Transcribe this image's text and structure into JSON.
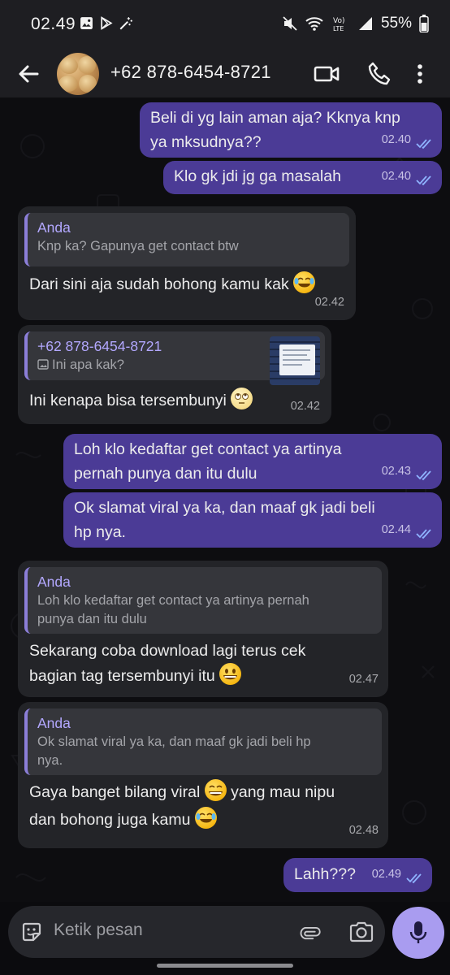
{
  "status_bar": {
    "time": "02.49",
    "battery": "55%",
    "icons": [
      "gallery-icon",
      "play-store-icon",
      "magic-wand-icon",
      "mute-icon",
      "wifi-icon",
      "volte-icon",
      "signal-icon",
      "battery-icon"
    ]
  },
  "header": {
    "contact": "+62 878-6454-8721",
    "icons": [
      "back-arrow-icon",
      "video-call-icon",
      "phone-icon",
      "more-vert-icon"
    ]
  },
  "messages": [
    {
      "side": "out",
      "lines": [
        "Beli di yg lain aman aja? Kknya knp",
        "ya mksudnya??"
      ],
      "time": "02.40",
      "read": true
    },
    {
      "side": "out",
      "lines": [
        "Klo gk jdi jg ga masalah"
      ],
      "time": "02.40",
      "read": true
    },
    {
      "side": "in",
      "reply_to": {
        "name": "Anda",
        "text": "Knp ka? Gapunya get contact btw"
      },
      "text": "Dari sini aja sudah bohong kamu kak",
      "emoji": "joy-emoji",
      "time": "02.42"
    },
    {
      "side": "in",
      "reply_to": {
        "name": "+62 878-6454-8721",
        "text": "Ini apa kak?",
        "has_image": true
      },
      "text": "Ini kenapa bisa tersembunyi",
      "emoji": "rolling-eyes-emoji",
      "time": "02.42"
    },
    {
      "side": "out",
      "lines": [
        "Loh klo kedaftar get contact ya artinya",
        "pernah punya dan itu dulu"
      ],
      "time": "02.43",
      "read": true
    },
    {
      "side": "out",
      "lines": [
        "Ok slamat viral ya ka, dan maaf gk jadi beli",
        "hp nya."
      ],
      "time": "02.44",
      "read": true
    },
    {
      "side": "in",
      "reply_to": {
        "name": "Anda",
        "lines": [
          "Loh klo kedaftar get contact ya artinya pernah",
          "punya dan itu dulu"
        ]
      },
      "lines": [
        "Sekarang coba download lagi terus cek",
        "bagian tag tersembunyi itu"
      ],
      "emoji": "grin-emoji",
      "time": "02.47"
    },
    {
      "side": "in",
      "reply_to": {
        "name": "Anda",
        "lines": [
          "Ok slamat viral ya ka, dan maaf gk jadi beli hp",
          "nya."
        ]
      },
      "lines": [
        "Gaya banget bilang viral",
        "yang mau nipu",
        "dan bohong juga kamu"
      ],
      "time": "02.48"
    },
    {
      "side": "out",
      "lines": [
        "Lahh???"
      ],
      "time": "02.49",
      "read": true
    }
  ],
  "input": {
    "placeholder": "Ketik pesan",
    "icons": [
      "sticker-icon",
      "attach-icon",
      "camera-icon",
      "mic-icon"
    ]
  },
  "colors": {
    "outgoing_bubble": "#4b3b96",
    "incoming_bubble": "#232428",
    "mic_button": "#a99cf0",
    "quote_name": "#b3a8ff"
  }
}
